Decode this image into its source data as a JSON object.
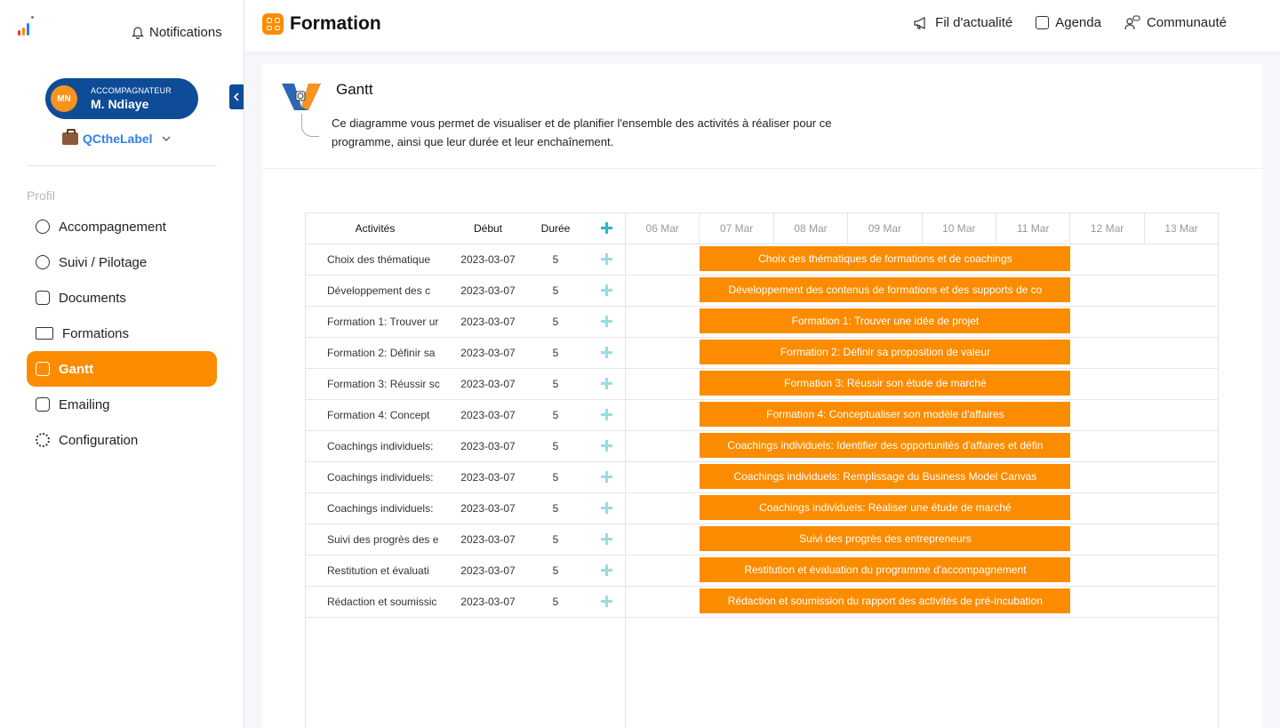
{
  "sidebar": {
    "notifications": "Notifications",
    "user": {
      "initials": "MN",
      "role": "ACCOMPAGNATEUR",
      "name": "M. Ndiaye"
    },
    "org": "QCtheLabel",
    "section": "Profil",
    "items": [
      {
        "label": "Accompagnement",
        "icon": "users-icon"
      },
      {
        "label": "Suivi / Pilotage",
        "icon": "pie-chart-icon"
      },
      {
        "label": "Documents",
        "icon": "folder-icon"
      },
      {
        "label": "Formations",
        "icon": "id-card-icon"
      },
      {
        "label": "Gantt",
        "icon": "document-icon",
        "active": true
      },
      {
        "label": "Emailing",
        "icon": "mail-icon"
      },
      {
        "label": "Configuration",
        "icon": "gear-icon"
      }
    ]
  },
  "topbar": {
    "title": "Formation",
    "nav": [
      {
        "label": "Fil d'actualité",
        "icon": "megaphone-icon"
      },
      {
        "label": "Agenda",
        "icon": "calendar-icon"
      },
      {
        "label": "Communauté",
        "icon": "community-icon"
      }
    ]
  },
  "gantt": {
    "heading": "Gantt",
    "description": "Ce diagramme vous permet de visualiser et de planifier l'ensemble des activités à réaliser pour ce programme, ainsi que leur durée et leur enchaînement.",
    "columns": {
      "activities": "Activités",
      "start": "Début",
      "duration": "Durée"
    },
    "days": [
      "06 Mar",
      "07 Mar",
      "08 Mar",
      "09 Mar",
      "10 Mar",
      "11 Mar",
      "12 Mar",
      "13 Mar"
    ],
    "bar_color": "#fb8c00",
    "tasks": [
      {
        "short": "Choix des thématique",
        "start": "2023-03-07",
        "duration": "5",
        "bar": "Choix des thématiques de formations et de coachings"
      },
      {
        "short": "Développement des c",
        "start": "2023-03-07",
        "duration": "5",
        "bar": "Développement des contenus de formations et des supports de co"
      },
      {
        "short": "Formation 1: Trouver ur",
        "start": "2023-03-07",
        "duration": "5",
        "bar": "Formation 1: Trouver une idée de projet"
      },
      {
        "short": "Formation 2: Définir sa",
        "start": "2023-03-07",
        "duration": "5",
        "bar": "Formation 2: Définir sa proposition de valeur"
      },
      {
        "short": "Formation 3: Réussir sc",
        "start": "2023-03-07",
        "duration": "5",
        "bar": "Formation 3: Réussir son étude de marché"
      },
      {
        "short": "Formation 4: Concept",
        "start": "2023-03-07",
        "duration": "5",
        "bar": "Formation 4: Conceptualiser son modèle d'affaires"
      },
      {
        "short": "Coachings individuels:",
        "start": "2023-03-07",
        "duration": "5",
        "bar": "Coachings individuels: Identifier des opportunités d'affaires et défin"
      },
      {
        "short": "Coachings individuels:",
        "start": "2023-03-07",
        "duration": "5",
        "bar": "Coachings individuels: Remplissage du Business Model Canvas"
      },
      {
        "short": "Coachings individuels:",
        "start": "2023-03-07",
        "duration": "5",
        "bar": "Coachings individuels: Réaliser une étude de marché"
      },
      {
        "short": "Suivi des progrès des e",
        "start": "2023-03-07",
        "duration": "5",
        "bar": "Suivi des progrès des entrepreneurs"
      },
      {
        "short": "Restitution et évaluati",
        "start": "2023-03-07",
        "duration": "5",
        "bar": "Restitution et évaluation du programme d'accompagnement"
      },
      {
        "short": "Rédaction et soumissic",
        "start": "2023-03-07",
        "duration": "5",
        "bar": "Rédaction et soumission du rapport des activités de pré-incubation"
      }
    ]
  }
}
